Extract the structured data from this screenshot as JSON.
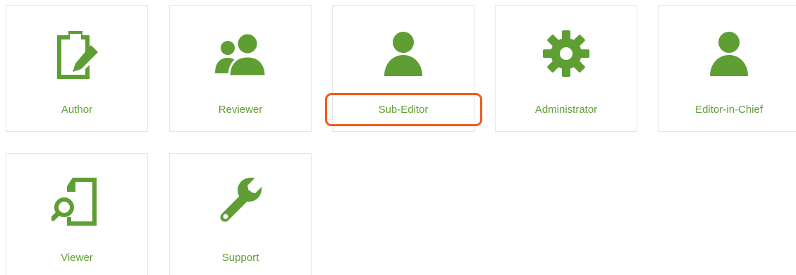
{
  "accent_color": "#5f9e33",
  "highlight_color": "#f05a1a",
  "roles": [
    {
      "label": "Author",
      "icon": "clipboard-edit-icon"
    },
    {
      "label": "Reviewer",
      "icon": "users-icon"
    },
    {
      "label": "Sub-Editor",
      "icon": "user-icon",
      "highlighted": true
    },
    {
      "label": "Administrator",
      "icon": "gear-icon"
    },
    {
      "label": "Editor-in-Chief",
      "icon": "user-icon"
    },
    {
      "label": "Viewer",
      "icon": "document-search-icon"
    },
    {
      "label": "Support",
      "icon": "wrench-icon"
    }
  ]
}
